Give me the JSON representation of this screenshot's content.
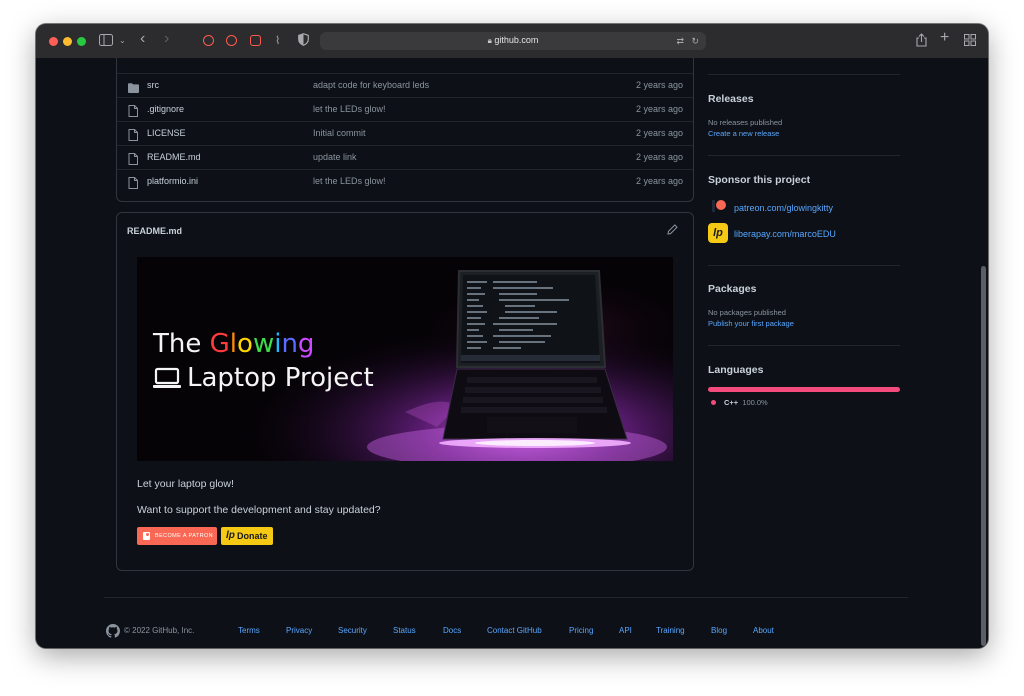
{
  "browser": {
    "url": "github.com"
  },
  "files": [
    {
      "type": "folder",
      "name": "src",
      "message": "adapt code for keyboard leds",
      "age": "2 years ago"
    },
    {
      "type": "file",
      "name": ".gitignore",
      "message": "let the LEDs glow!",
      "age": "2 years ago"
    },
    {
      "type": "file",
      "name": "LICENSE",
      "message": "Initial commit",
      "age": "2 years ago"
    },
    {
      "type": "file",
      "name": "README.md",
      "message": "update link",
      "age": "2 years ago"
    },
    {
      "type": "file",
      "name": "platformio.ini",
      "message": "let the LEDs glow!",
      "age": "2 years ago"
    }
  ],
  "readme": {
    "title": "README.md",
    "banner_line1_prefix": "The ",
    "banner_line1_glow": [
      "G",
      "l",
      "o",
      "w",
      "i",
      "n",
      "g"
    ],
    "banner_line2": "Laptop Project",
    "para1": "Let your laptop glow!",
    "para2": "Want to support the development and stay updated?",
    "patron_button": "BECOME A PATRON",
    "donate_button": "Donate"
  },
  "sidebar": {
    "releases": {
      "heading": "Releases",
      "status": "No releases published",
      "link": "Create a new release"
    },
    "sponsor": {
      "heading": "Sponsor this project",
      "links": [
        "patreon.com/glowingkitty",
        "liberapay.com/marcoEDU"
      ]
    },
    "packages": {
      "heading": "Packages",
      "status": "No packages published",
      "link": "Publish your first package"
    },
    "languages": {
      "heading": "Languages",
      "name": "C++",
      "percent": "100.0%",
      "fraction": 1.0,
      "color": "#f34b7d"
    }
  },
  "footer": {
    "copyright": "© 2022 GitHub, Inc.",
    "links": [
      "Terms",
      "Privacy",
      "Security",
      "Status",
      "Docs",
      "Contact GitHub",
      "Pricing",
      "API",
      "Training",
      "Blog",
      "About"
    ]
  },
  "colors": {
    "link": "#58a6ff",
    "patreon": "#f96854",
    "liberapay": "#f6c915",
    "glow": [
      "#ff3b3b",
      "#ff8a00",
      "#ffd400",
      "#3ddc4a",
      "#21b8ff",
      "#5a6bff",
      "#c84bff"
    ]
  }
}
